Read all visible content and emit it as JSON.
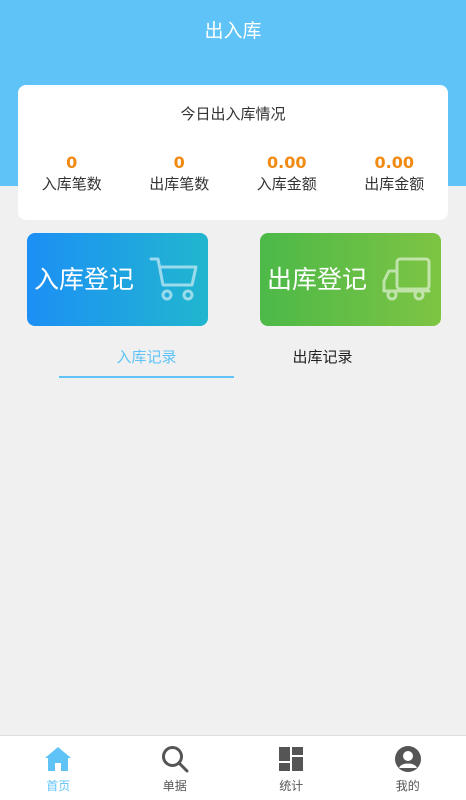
{
  "header": {
    "title": "出入库"
  },
  "summary": {
    "title": "今日出入库情况",
    "stats": [
      {
        "value": "0",
        "label": "入库笔数"
      },
      {
        "value": "0",
        "label": "出库笔数"
      },
      {
        "value": "0.00",
        "label": "入库金额"
      },
      {
        "value": "0.00",
        "label": "出库金额"
      }
    ]
  },
  "actions": {
    "stock_in": {
      "label": "入库登记",
      "icon": "cart-icon"
    },
    "stock_out": {
      "label": "出库登记",
      "icon": "truck-icon"
    }
  },
  "tabs": [
    {
      "label": "入库记录",
      "active": true
    },
    {
      "label": "出库记录",
      "active": false
    }
  ],
  "bottom_nav": [
    {
      "label": "首页",
      "icon": "home-icon",
      "active": true
    },
    {
      "label": "单据",
      "icon": "search-icon",
      "active": false
    },
    {
      "label": "统计",
      "icon": "grid-icon",
      "active": false
    },
    {
      "label": "我的",
      "icon": "user-icon",
      "active": false
    }
  ],
  "colors": {
    "primary": "#5fc3f7",
    "accent_number": "#f08a12",
    "stock_in_gradient": [
      "#1c8ff5",
      "#21b6cf"
    ],
    "stock_out_gradient": [
      "#4cb948",
      "#7ec443"
    ],
    "background": "#f0f0f0"
  }
}
